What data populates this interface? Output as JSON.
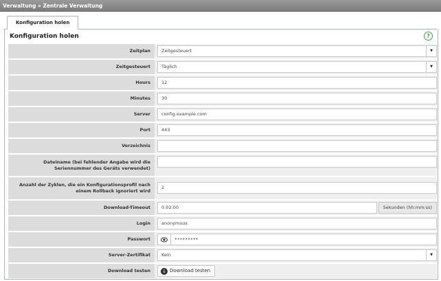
{
  "titlebar": {
    "breadcrumb": "Verwaltung » Zentrale Verwaltung"
  },
  "tabs": [
    {
      "label": "Konfiguration holen"
    }
  ],
  "panel": {
    "title": "Konfiguration holen",
    "help_icon": "help-circle-icon"
  },
  "form": {
    "zeitplan": {
      "label": "Zeitplan",
      "value": "Zeitgesteuert"
    },
    "zeitgesteuert": {
      "label": "Zeitgesteuert",
      "value": "Täglich"
    },
    "hours": {
      "label": "Hours",
      "value": "12"
    },
    "minutes": {
      "label": "Minutes",
      "value": "30"
    },
    "server": {
      "label": "Server",
      "value": "config.example.com"
    },
    "port": {
      "label": "Port",
      "value": "443"
    },
    "verzeichnis": {
      "label": "Verzeichnis",
      "value": ""
    },
    "dateiname": {
      "label": "Dateiname (bei fehlender Angabe wird die Seriennummer des Geräts verwendet)",
      "value": ""
    },
    "zyklen": {
      "label": "Anzahl der Zyklen, die ein Konfigurationsprofil nach einem Rollback ignoriert wird",
      "value": "2"
    },
    "download_timeout": {
      "label": "Download-Timeout",
      "value": "0:02:00",
      "unit": "Sekunden (hh:mm:ss)"
    },
    "login": {
      "label": "Login",
      "value": "anonymous"
    },
    "passwort": {
      "label": "Passwort",
      "value": "•••••••••"
    },
    "server_zertifikat": {
      "label": "Server-Zertifikat",
      "value": "Kein"
    },
    "download_testen": {
      "label": "Download testen",
      "button": "Download testen"
    }
  }
}
